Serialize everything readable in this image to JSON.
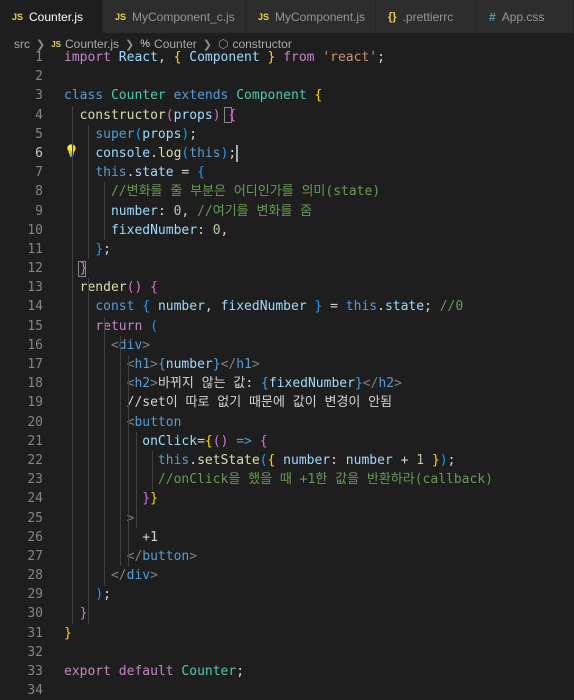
{
  "tabs": [
    {
      "label": "Counter.js",
      "icon": "JS",
      "active": true,
      "modified": true
    },
    {
      "label": "MyComponent_c.js",
      "icon": "JS",
      "active": false
    },
    {
      "label": "MyComponent.js",
      "icon": "JS",
      "active": false
    },
    {
      "label": ".prettierrc",
      "icon": "{}",
      "active": false
    },
    {
      "label": "App.css",
      "icon": "#",
      "active": false
    }
  ],
  "breadcrumb": {
    "folder": "src",
    "file_icon": "JS",
    "file": "Counter.js",
    "class_icon": "%",
    "class": "Counter",
    "method_icon": "⬡",
    "method": "constructor"
  },
  "editor": {
    "current_line": 6,
    "lightbulb_icon": "💡",
    "line_numbers": [
      "1",
      "2",
      "3",
      "4",
      "5",
      "6",
      "7",
      "8",
      "9",
      "10",
      "11",
      "12",
      "13",
      "14",
      "15",
      "16",
      "17",
      "18",
      "19",
      "20",
      "21",
      "22",
      "23",
      "24",
      "25",
      "26",
      "27",
      "28",
      "29",
      "30",
      "31",
      "32",
      "33",
      "34"
    ],
    "lines": [
      [
        [
          "kw",
          "import"
        ],
        [
          "txt",
          " "
        ],
        [
          "var",
          "React"
        ],
        [
          "txt",
          ", "
        ],
        [
          "b1",
          "{"
        ],
        [
          "txt",
          " "
        ],
        [
          "var",
          "Component"
        ],
        [
          "txt",
          " "
        ],
        [
          "b1",
          "}"
        ],
        [
          "txt",
          " "
        ],
        [
          "kw",
          "from"
        ],
        [
          "txt",
          " "
        ],
        [
          "str",
          "'react'"
        ],
        [
          "txt",
          ";"
        ]
      ],
      [],
      [
        [
          "sk",
          "class"
        ],
        [
          "txt",
          " "
        ],
        [
          "cls",
          "Counter"
        ],
        [
          "txt",
          " "
        ],
        [
          "sk",
          "extends"
        ],
        [
          "txt",
          " "
        ],
        [
          "cls",
          "Component"
        ],
        [
          "txt",
          " "
        ],
        [
          "b1",
          "{"
        ]
      ],
      [
        [
          "txt",
          "  "
        ],
        [
          "fn",
          "constructor"
        ],
        [
          "b2",
          "("
        ],
        [
          "var",
          "props"
        ],
        [
          "b2",
          ")"
        ],
        [
          "txt",
          " "
        ],
        [
          "b2",
          "{"
        ]
      ],
      [
        [
          "txt",
          "    "
        ],
        [
          "sk",
          "super"
        ],
        [
          "b3",
          "("
        ],
        [
          "var",
          "props"
        ],
        [
          "b3",
          ")"
        ],
        [
          "txt",
          ";"
        ]
      ],
      [
        [
          "txt",
          "    "
        ],
        [
          "var",
          "console"
        ],
        [
          "txt",
          "."
        ],
        [
          "fn",
          "log"
        ],
        [
          "b3",
          "("
        ],
        [
          "sk",
          "this"
        ],
        [
          "b3",
          ")"
        ],
        [
          "txt",
          ";"
        ]
      ],
      [
        [
          "txt",
          "    "
        ],
        [
          "sk",
          "this"
        ],
        [
          "txt",
          "."
        ],
        [
          "var",
          "state"
        ],
        [
          "txt",
          " = "
        ],
        [
          "b3",
          "{"
        ]
      ],
      [
        [
          "txt",
          "      "
        ],
        [
          "cmt",
          "//변화를 줄 부분은 어디인가를 의미(state)"
        ]
      ],
      [
        [
          "txt",
          "      "
        ],
        [
          "var",
          "number"
        ],
        [
          "txt",
          ": "
        ],
        [
          "num",
          "0"
        ],
        [
          "txt",
          ", "
        ],
        [
          "cmt",
          "//여기를 변화를 줌"
        ]
      ],
      [
        [
          "txt",
          "      "
        ],
        [
          "var",
          "fixedNumber"
        ],
        [
          "txt",
          ": "
        ],
        [
          "num",
          "0"
        ],
        [
          "txt",
          ","
        ]
      ],
      [
        [
          "txt",
          "    "
        ],
        [
          "b3",
          "}"
        ],
        [
          "txt",
          ";"
        ]
      ],
      [
        [
          "txt",
          "  "
        ],
        [
          "b2",
          "}"
        ]
      ],
      [
        [
          "txt",
          "  "
        ],
        [
          "fn",
          "render"
        ],
        [
          "b2",
          "("
        ],
        [
          "b2",
          ")"
        ],
        [
          "txt",
          " "
        ],
        [
          "b2",
          "{"
        ]
      ],
      [
        [
          "txt",
          "    "
        ],
        [
          "sk",
          "const"
        ],
        [
          "txt",
          " "
        ],
        [
          "b3",
          "{"
        ],
        [
          "txt",
          " "
        ],
        [
          "var",
          "number"
        ],
        [
          "txt",
          ", "
        ],
        [
          "var",
          "fixedNumber"
        ],
        [
          "txt",
          " "
        ],
        [
          "b3",
          "}"
        ],
        [
          "txt",
          " = "
        ],
        [
          "sk",
          "this"
        ],
        [
          "txt",
          "."
        ],
        [
          "var",
          "state"
        ],
        [
          "txt",
          "; "
        ],
        [
          "cmt",
          "//0"
        ]
      ],
      [
        [
          "txt",
          "    "
        ],
        [
          "kw",
          "return"
        ],
        [
          "txt",
          " "
        ],
        [
          "b3",
          "("
        ]
      ],
      [
        [
          "txt",
          "      "
        ],
        [
          "punc",
          "<"
        ],
        [
          "tag",
          "div"
        ],
        [
          "punc",
          ">"
        ]
      ],
      [
        [
          "txt",
          "        "
        ],
        [
          "punc",
          "<"
        ],
        [
          "tag",
          "h1"
        ],
        [
          "punc",
          ">"
        ],
        [
          "sk",
          "{"
        ],
        [
          "var",
          "number"
        ],
        [
          "sk",
          "}"
        ],
        [
          "punc",
          "</"
        ],
        [
          "tag",
          "h1"
        ],
        [
          "punc",
          ">"
        ]
      ],
      [
        [
          "txt",
          "        "
        ],
        [
          "punc",
          "<"
        ],
        [
          "tag",
          "h2"
        ],
        [
          "punc",
          ">"
        ],
        [
          "txt",
          "바뀌지 않는 값: "
        ],
        [
          "sk",
          "{"
        ],
        [
          "var",
          "fixedNumber"
        ],
        [
          "sk",
          "}"
        ],
        [
          "punc",
          "</"
        ],
        [
          "tag",
          "h2"
        ],
        [
          "punc",
          ">"
        ]
      ],
      [
        [
          "txt",
          "        //set이 따로 없기 때문에 값이 변경이 안됨"
        ]
      ],
      [
        [
          "txt",
          "        "
        ],
        [
          "punc",
          "<"
        ],
        [
          "tag",
          "button"
        ]
      ],
      [
        [
          "txt",
          "          "
        ],
        [
          "var",
          "onClick"
        ],
        [
          "txt",
          "="
        ],
        [
          "b1",
          "{"
        ],
        [
          "b2",
          "("
        ],
        [
          "b2",
          ")"
        ],
        [
          "txt",
          " "
        ],
        [
          "sk",
          "=>"
        ],
        [
          "txt",
          " "
        ],
        [
          "b2",
          "{"
        ]
      ],
      [
        [
          "txt",
          "            "
        ],
        [
          "sk",
          "this"
        ],
        [
          "txt",
          "."
        ],
        [
          "fn",
          "setState"
        ],
        [
          "b3",
          "("
        ],
        [
          "b1",
          "{"
        ],
        [
          "txt",
          " "
        ],
        [
          "var",
          "number"
        ],
        [
          "txt",
          ": "
        ],
        [
          "var",
          "number"
        ],
        [
          "txt",
          " + "
        ],
        [
          "num",
          "1"
        ],
        [
          "txt",
          " "
        ],
        [
          "b1",
          "}"
        ],
        [
          "b3",
          ")"
        ],
        [
          "txt",
          ";"
        ]
      ],
      [
        [
          "txt",
          "            "
        ],
        [
          "cmt",
          "//onClick을 했을 때 +1한 값을 반환하라(callback)"
        ]
      ],
      [
        [
          "txt",
          "          "
        ],
        [
          "b2",
          "}"
        ],
        [
          "b1",
          "}"
        ]
      ],
      [
        [
          "txt",
          "        "
        ],
        [
          "punc",
          ">"
        ]
      ],
      [
        [
          "txt",
          "          +1"
        ]
      ],
      [
        [
          "txt",
          "        "
        ],
        [
          "punc",
          "</"
        ],
        [
          "tag",
          "button"
        ],
        [
          "punc",
          ">"
        ]
      ],
      [
        [
          "txt",
          "      "
        ],
        [
          "punc",
          "</"
        ],
        [
          "tag",
          "div"
        ],
        [
          "punc",
          ">"
        ]
      ],
      [
        [
          "txt",
          "    "
        ],
        [
          "b3",
          ")"
        ],
        [
          "txt",
          ";"
        ]
      ],
      [
        [
          "txt",
          "  "
        ],
        [
          "b2",
          "}"
        ]
      ],
      [
        [
          "b1",
          "}"
        ]
      ],
      [],
      [
        [
          "kw",
          "export"
        ],
        [
          "txt",
          " "
        ],
        [
          "kw",
          "default"
        ],
        [
          "txt",
          " "
        ],
        [
          "cls",
          "Counter"
        ],
        [
          "txt",
          ";"
        ]
      ],
      []
    ]
  }
}
